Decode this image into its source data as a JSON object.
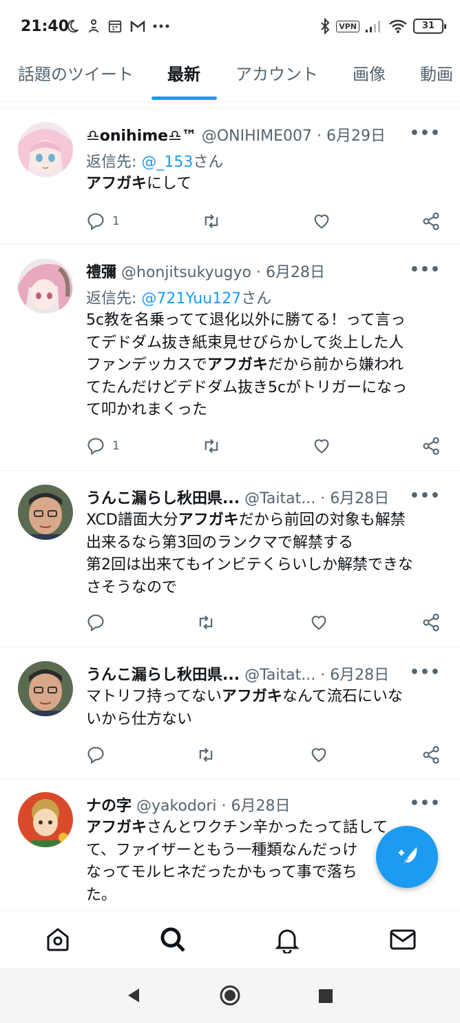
{
  "status_bar": {
    "time": "21:40",
    "vpn": "VPN",
    "battery": "31"
  },
  "tabs": [
    {
      "label": "話題のツイート",
      "active": false
    },
    {
      "label": "最新",
      "active": true
    },
    {
      "label": "アカウント",
      "active": false
    },
    {
      "label": "画像",
      "active": false
    },
    {
      "label": "動画",
      "active": false
    }
  ],
  "tweets": [
    {
      "name": "♎onihime♎™",
      "handle": "@ONIHIME007",
      "sep": "·",
      "date": "6月29日",
      "reply_prefix": "返信先: ",
      "reply_to": "@_153",
      "reply_suffix": "さん",
      "body_lines": [
        "<b>アフガキ</b>にして"
      ],
      "reply_count": "1",
      "more": "•••"
    },
    {
      "name": "禮彌",
      "handle": "@honjitsukyugyo",
      "sep": "·",
      "date": "6月28日",
      "reply_prefix": "返信先: ",
      "reply_to": "@721Yuu127",
      "reply_suffix": "さん",
      "body_lines": [
        "5c教を名乗ってて退化以外に勝てる！って言っ",
        "てデドダム抜き紙束見せびらかして炎上した人",
        "ファンデッカスで<b>アフガキ</b>だから前から嫌われ",
        "てたんだけどデドダム抜き5cがトリガーになっ",
        "て叩かれまくった"
      ],
      "reply_count": "1",
      "more": "•••"
    },
    {
      "name": "うんこ漏らし秋田県...",
      "handle": "@Taitat...",
      "sep": "·",
      "date": "6月28日",
      "body_lines": [
        "XCD譜面大分<b>アフガキ</b>だから前回の対象も解禁",
        "出来るなら第3回のランクマで解禁する",
        "第2回は出来てもインビテくらいしか解禁できな",
        "さそうなので"
      ],
      "reply_count": "",
      "more": "•••"
    },
    {
      "name": "うんこ漏らし秋田県...",
      "handle": "@Taitat...",
      "sep": "·",
      "date": "6月28日",
      "body_lines": [
        "マトリフ持ってない<b>アフガキ</b>なんて流石にいな",
        "いから仕方ない"
      ],
      "reply_count": "",
      "more": "•••"
    },
    {
      "name": "ナの字",
      "handle": "@yakodori",
      "sep": "·",
      "date": "6月28日",
      "body_lines": [
        "<b>アフガキ</b>さんとワクチン辛かったって話して",
        "て、ファイザーともう一種類なんだっけ",
        "なってモルヒネだったかもって事で落ち",
        "た。"
      ],
      "reply_count": "",
      "more": "•••"
    }
  ],
  "icons": {
    "reply": "reply-icon",
    "retweet": "retweet-icon",
    "like": "heart-icon",
    "share": "share-icon",
    "compose": "compose-tweet-icon",
    "home": "home-icon",
    "search": "search-icon",
    "notifications": "bell-icon",
    "messages": "mail-icon"
  },
  "colors": {
    "accent": "#1d9bf0",
    "secondary_text": "#536471"
  }
}
